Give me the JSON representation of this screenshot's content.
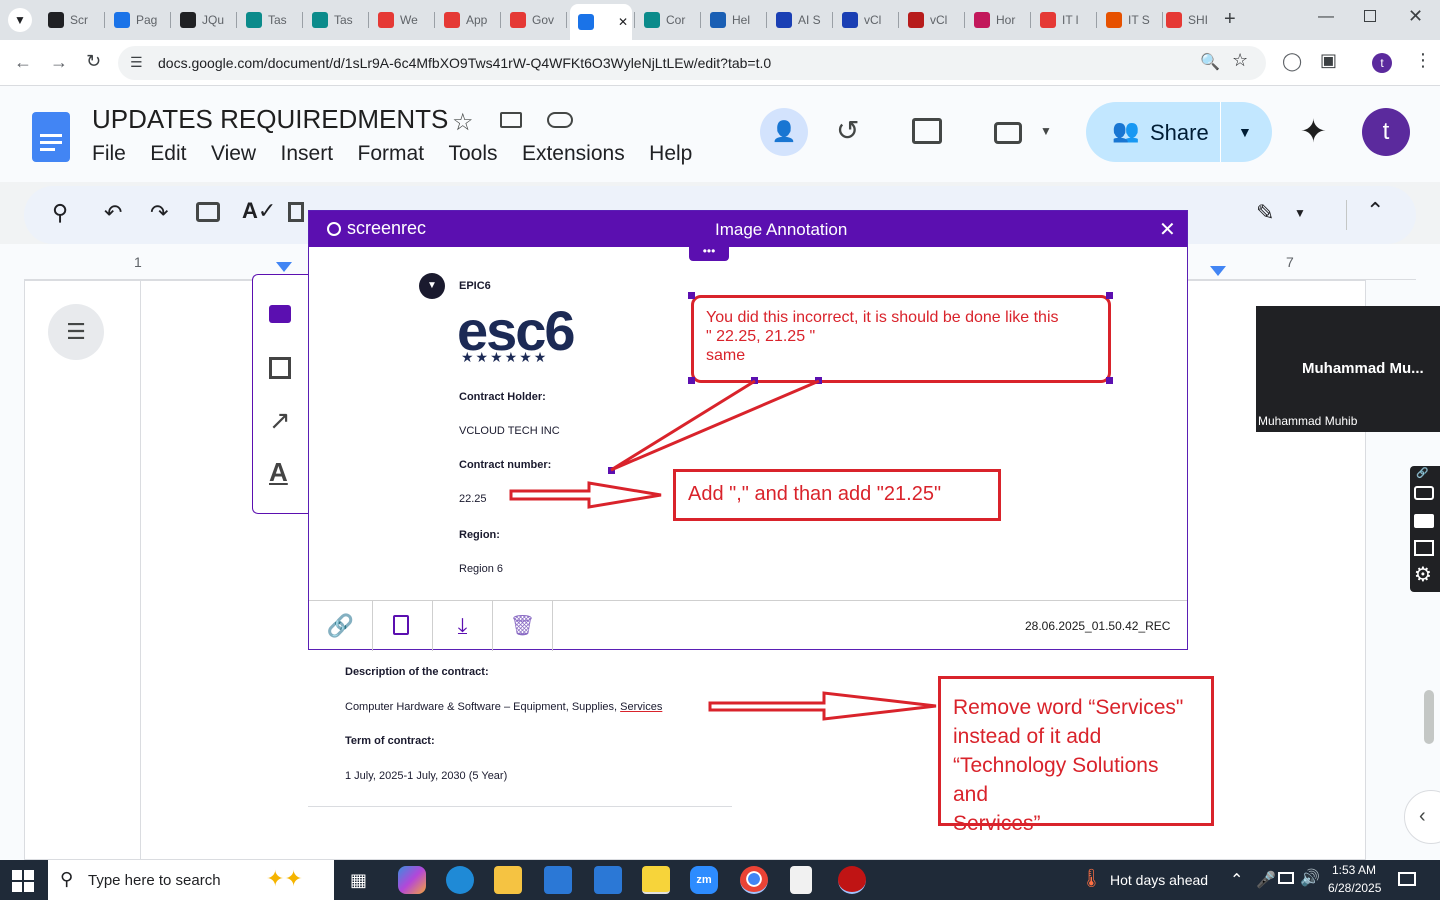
{
  "browser": {
    "tabs": [
      {
        "label": "Scr",
        "color": "#202124"
      },
      {
        "label": "Pag",
        "color": "#1a73e8"
      },
      {
        "label": "JQu",
        "color": "#202124"
      },
      {
        "label": "Tas",
        "color": "#0b8b8b"
      },
      {
        "label": "Tas",
        "color": "#0b8b8b"
      },
      {
        "label": "We",
        "color": "#e53935"
      },
      {
        "label": "App",
        "color": "#e53935"
      },
      {
        "label": "Gov",
        "color": "#e53935"
      },
      {
        "label": "",
        "color": "#1a73e8"
      },
      {
        "label": "Cor",
        "color": "#0b8b8b"
      },
      {
        "label": "Hel",
        "color": "#1a5fb4"
      },
      {
        "label": "AI S",
        "color": "#1a3fb4"
      },
      {
        "label": "vCl",
        "color": "#1a3fb4"
      },
      {
        "label": "vCl",
        "color": "#b71c1c"
      },
      {
        "label": "Hor",
        "color": "#c2185b"
      },
      {
        "label": "IT l",
        "color": "#e53935"
      },
      {
        "label": "IT S",
        "color": "#e65100"
      },
      {
        "label": "SHI",
        "color": "#e53935"
      }
    ],
    "url": "docs.google.com/document/d/1sLr9A-6c4MfbXO9Tws41rW-Q4WFKt6O3WyleNjLtLEw/edit?tab=t.0",
    "profile_initial": "t"
  },
  "docs": {
    "title": "UPDATES REQUIREDMENTS",
    "menu": [
      "File",
      "Edit",
      "View",
      "Insert",
      "Format",
      "Tools",
      "Extensions",
      "Help"
    ],
    "share_label": "Share",
    "avatar_initial": "t",
    "ruler_left": "1",
    "ruler_right": "7"
  },
  "video_tile": {
    "name_big": "Muhammad  Mu...",
    "name_small": "Muhammad Muhib"
  },
  "screenrec": {
    "logo": "screenrec",
    "title": "Image Annotation",
    "filename": "28.06.2025_01.50.42_REC",
    "note_text_line1": "You did this incorrect, it is should be done like this",
    "note_text_line2": "\" 22.25, 21.25 \"",
    "note_text_line3": "same",
    "add_note": "Add \",\" and than add \"21.25\""
  },
  "contract": {
    "brand_small": "EPIC6",
    "logo_text": "esc6",
    "holder_label": "Contract Holder:",
    "holder_value": "VCLOUD TECH INC",
    "number_label": "Contract number:",
    "number_value": "22.25",
    "region_label": "Region:",
    "region_value": "Region 6",
    "desc_label": "Description of the contract:",
    "desc_value_prefix": "Computer Hardware & Software – Equipment, Supplies, ",
    "desc_value_services": "Services",
    "term_label": "Term of contract:",
    "term_value": "1 July, 2025-1 July, 2030 (5 Year)"
  },
  "remove_note": {
    "line1": "Remove word “Services\"",
    "line2": "instead of it add",
    "line3": "“Technology Solutions and",
    "line4": "Services”"
  },
  "taskbar": {
    "search_placeholder": "Type here to search",
    "weather": "Hot days ahead",
    "time": "1:53 AM",
    "date": "6/28/2025"
  }
}
